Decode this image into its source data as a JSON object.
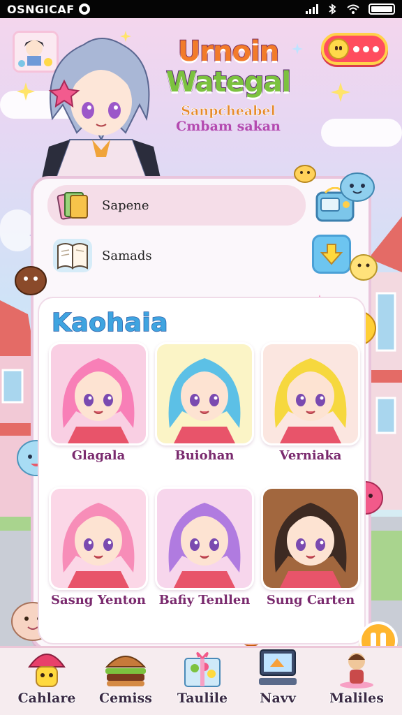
{
  "status_bar": {
    "carrier": "OSNGICAF"
  },
  "header": {
    "title_line1": "Urnoin",
    "title_line2": "Wategal",
    "subtitle_line1": "Sanpcheabel",
    "subtitle_line2": "Cmbam sakan"
  },
  "menu": {
    "items": [
      {
        "label": "Sapene",
        "icon": "card-deck-icon"
      },
      {
        "label": "Samads",
        "icon": "open-book-icon"
      }
    ]
  },
  "section": {
    "title": "Kaohaia",
    "characters": [
      {
        "name": "Glagala",
        "hair": "#f87fb7",
        "bg": "#f9cfe3"
      },
      {
        "name": "Buiohan",
        "hair": "#5cc0e6",
        "bg": "#fbf4c6"
      },
      {
        "name": "Verniaka",
        "hair": "#f6d83e",
        "bg": "#fbe6e0"
      },
      {
        "name": "Sasng Yenton",
        "hair": "#f78db8",
        "bg": "#fbd7e7"
      },
      {
        "name": "Bafiy Tenllen",
        "hair": "#b07be0",
        "bg": "#f7d6ec"
      },
      {
        "name": "Sung Carten",
        "hair": "#3d2a22",
        "bg": "#a2673e"
      }
    ]
  },
  "bottom_nav": {
    "items": [
      {
        "label": "Cahlare",
        "icon": "mushroom-house-icon"
      },
      {
        "label": "Cemiss",
        "icon": "burger-icon"
      },
      {
        "label": "Taulile",
        "icon": "gift-box-icon"
      },
      {
        "label": "Navv",
        "icon": "computer-icon"
      },
      {
        "label": "Maliles",
        "icon": "character-icon"
      }
    ]
  },
  "colors": {
    "accent_pink": "#f6c2da",
    "title_orange": "#f27b2a",
    "title_green": "#7cc23f",
    "section_title_blue": "#3fa4e0",
    "chat_button_red": "#ff4d5e"
  }
}
